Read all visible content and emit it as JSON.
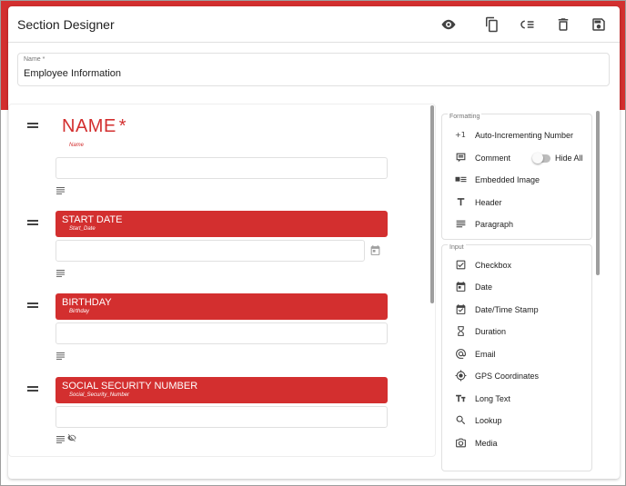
{
  "header": {
    "title": "Section Designer",
    "icons": [
      "eye-icon",
      "copy-icon",
      "list-icon",
      "delete-icon",
      "save-icon"
    ]
  },
  "name_field": {
    "label": "Name *",
    "value": "Employee Information"
  },
  "fields": [
    {
      "label": "NAME",
      "required_mark": "*",
      "subtitle": "Name"
    },
    {
      "label": "START DATE",
      "subtitle": "Start_Date"
    },
    {
      "label": "BIRTHDAY",
      "subtitle": "Birthday"
    },
    {
      "label": "SOCIAL SECURITY NUMBER",
      "subtitle": "Social_Security_Number"
    }
  ],
  "formatting": {
    "title": "Formatting",
    "items": [
      {
        "label": "Auto-Incrementing Number",
        "icon": "plus-one-icon"
      },
      {
        "label": "Comment",
        "icon": "comment-icon"
      },
      {
        "label": "Embedded Image",
        "icon": "embedded-image-icon"
      },
      {
        "label": "Header",
        "icon": "header-icon"
      },
      {
        "label": "Paragraph",
        "icon": "paragraph-icon"
      }
    ],
    "hide_all_label": "Hide All",
    "hide_all_on": false
  },
  "input": {
    "title": "Input",
    "items": [
      {
        "label": "Checkbox",
        "icon": "checkbox-icon"
      },
      {
        "label": "Date",
        "icon": "calendar-icon"
      },
      {
        "label": "Date/Time Stamp",
        "icon": "datetime-icon"
      },
      {
        "label": "Duration",
        "icon": "hourglass-icon"
      },
      {
        "label": "Email",
        "icon": "at-icon"
      },
      {
        "label": "GPS Coordinates",
        "icon": "gps-icon"
      },
      {
        "label": "Long Text",
        "icon": "long-text-icon"
      },
      {
        "label": "Lookup",
        "icon": "search-icon"
      },
      {
        "label": "Media",
        "icon": "camera-icon"
      }
    ]
  },
  "colors": {
    "accent": "#d32f2f",
    "text": "#212121",
    "muted": "#757575",
    "border": "#e0e0e0"
  }
}
